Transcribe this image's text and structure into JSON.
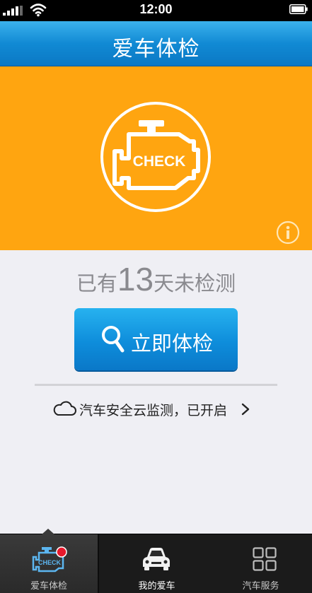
{
  "status_bar": {
    "time": "12:00"
  },
  "header": {
    "title": "爱车体检"
  },
  "hero": {
    "badge_text": "CHECK",
    "icons": [
      "check-engine-icon",
      "info-icon"
    ]
  },
  "main": {
    "days_prefix": "已有",
    "days_count": "13",
    "days_suffix": "天未检测",
    "check_button_label": "立即体检",
    "cloud_text": "汽车安全云监测，已开启"
  },
  "tabs": [
    {
      "label": "爱车体检",
      "icon": "check-engine-icon",
      "active": true,
      "has_badge": true
    },
    {
      "label": "我的爱车",
      "icon": "car-icon",
      "active": false
    },
    {
      "label": "汽车服务",
      "icon": "grid-icon",
      "active": false
    }
  ],
  "colors": {
    "accent": "#118ad4",
    "hero_background": "#ffa510",
    "background": "#efeff4",
    "tab_bar": "#1b1b1b",
    "badge": "#e8192c"
  }
}
